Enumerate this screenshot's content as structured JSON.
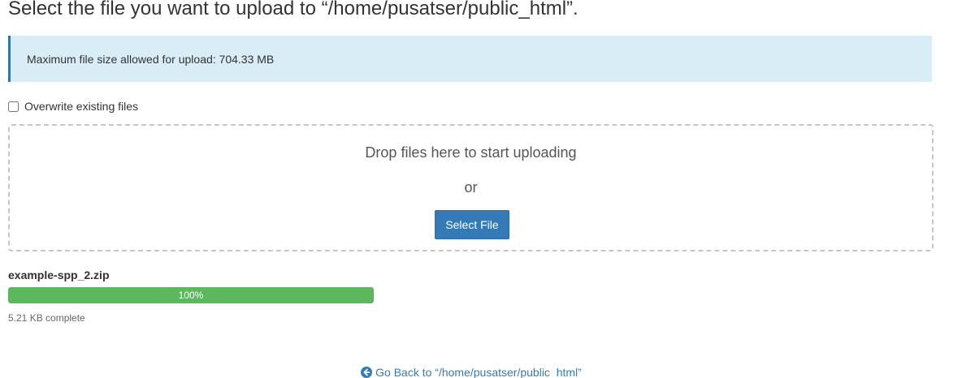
{
  "header": {
    "title": "Select the file you want to upload to “/home/pusatser/public_html”."
  },
  "info": {
    "max_size_text": "Maximum file size allowed for upload: 704.33 MB"
  },
  "options": {
    "overwrite_label": "Overwrite existing files",
    "overwrite_checked": false
  },
  "dropzone": {
    "drop_text": "Drop files here to start uploading",
    "or_text": "or",
    "select_button_label": "Select File"
  },
  "upload": {
    "file_name": "example-spp_2.zip",
    "progress_label": "100%",
    "progress_fraction": 1.0,
    "status_text": "5.21 KB complete"
  },
  "footer": {
    "back_link_text": "Go Back to “/home/pusatser/public_html”",
    "back_icon": "circle-arrow-left-icon"
  },
  "colors": {
    "primary": "#337ab7",
    "info_bg": "#d9edf7",
    "info_border": "#3174ac",
    "success": "#5cb85c"
  }
}
